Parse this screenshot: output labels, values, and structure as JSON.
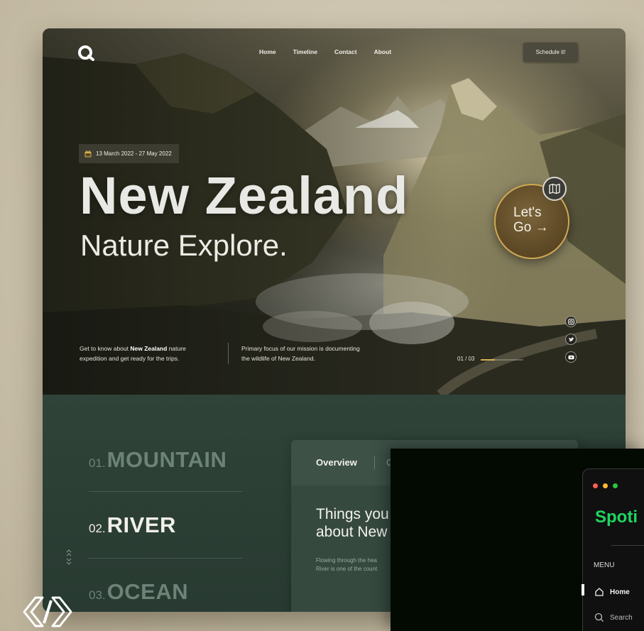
{
  "nav": {
    "items": [
      "Home",
      "Timeline",
      "Contact",
      "About"
    ],
    "cta": "Schedule it!"
  },
  "hero": {
    "date_range": "13 March 2022 - 27 May 2022",
    "title": "New Zealand",
    "subtitle": "Nature Explore.",
    "cta_line1": "Let's",
    "cta_line2": "Go →",
    "blurb_left_pre": "Get to know about ",
    "blurb_left_bold": "New Zealand",
    "blurb_left_post": " nature",
    "blurb_left_line2": "expedition and get ready for the trips.",
    "blurb_right_line1": "Primary focus of our mission is documenting",
    "blurb_right_line2": "the wildlife of New Zealand.",
    "slide_counter": "01 / 03",
    "slide_progress": 0.33,
    "accent": "#d7b04f"
  },
  "categories": [
    {
      "num": "01.",
      "name": "MOUNTAIN",
      "active": false
    },
    {
      "num": "02.",
      "name": "RIVER",
      "active": true
    },
    {
      "num": "03.",
      "name": "OCEAN",
      "active": false
    }
  ],
  "panel": {
    "tab_active": "Overview",
    "tab_next": "C",
    "heading_line1": "Things you",
    "heading_line2": "about New",
    "body_line1": "Flowing through the hea",
    "body_line2": "River is one of the count"
  },
  "spotify": {
    "logo": "Spoti",
    "menu_label": "MENU",
    "items": [
      "Home",
      "Search"
    ],
    "brand_color": "#1ed760",
    "dot_colors": [
      "#ff5f57",
      "#febc2e",
      "#28c840"
    ]
  },
  "icons": {
    "logo": "search-q-logo-icon",
    "calendar": "calendar-icon",
    "map": "map-icon",
    "socials": [
      "instagram-icon",
      "twitter-icon",
      "youtube-icon"
    ],
    "home": "home-icon",
    "search": "search-icon"
  }
}
